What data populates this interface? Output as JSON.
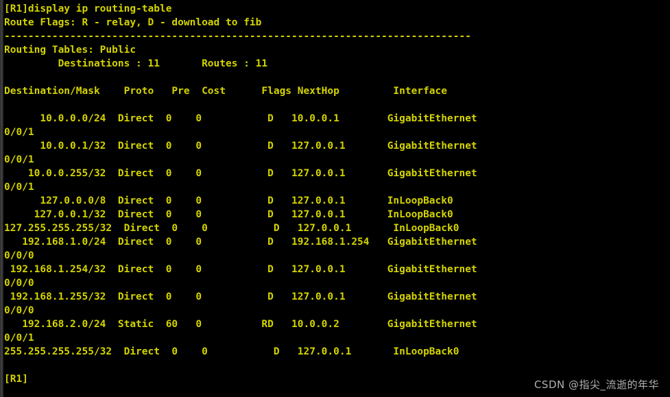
{
  "terminal": {
    "prompt": "[R1]",
    "command": "display ip routing-table",
    "command_line": "[R1]display ip routing-table",
    "flags_legend": "Route Flags: R - relay, D - download to fib",
    "separator": "------------------------------------------------------------------------------",
    "table_name": "Routing Tables: Public",
    "summary_line": "         Destinations : 11       Routes : 11",
    "destinations_label": "Destinations",
    "destinations_count": "11",
    "routes_label": "Routes",
    "routes_count": "11",
    "trailing_prompt": "[R1]",
    "colors": {
      "background": "#000000",
      "text": "#d4d400",
      "gutter": "#434343",
      "watermark": "#c9c9c9"
    }
  },
  "table": {
    "headers": {
      "destination_mask": "Destination/Mask",
      "proto": "Proto",
      "pre": "Pre",
      "cost": "Cost",
      "flags": "Flags",
      "nexthop": "NextHop",
      "interface": "Interface"
    },
    "header_line": "Destination/Mask    Proto   Pre  Cost      Flags NextHop         Interface",
    "rows": [
      {
        "destination_mask": "10.0.0.0/24",
        "proto": "Direct",
        "pre": "0",
        "cost": "0",
        "flags": "D",
        "nexthop": "10.0.0.1",
        "interface": "GigabitEthernet",
        "interface_cont": "0/0/1",
        "line": "      10.0.0.0/24  Direct  0    0           D   10.0.0.1        GigabitEthernet",
        "line_cont": "0/0/1"
      },
      {
        "destination_mask": "10.0.0.1/32",
        "proto": "Direct",
        "pre": "0",
        "cost": "0",
        "flags": "D",
        "nexthop": "127.0.0.1",
        "interface": "GigabitEthernet",
        "interface_cont": "0/0/1",
        "line": "      10.0.0.1/32  Direct  0    0           D   127.0.0.1       GigabitEthernet",
        "line_cont": "0/0/1"
      },
      {
        "destination_mask": "10.0.0.255/32",
        "proto": "Direct",
        "pre": "0",
        "cost": "0",
        "flags": "D",
        "nexthop": "127.0.0.1",
        "interface": "GigabitEthernet",
        "interface_cont": "0/0/1",
        "line": "    10.0.0.255/32  Direct  0    0           D   127.0.0.1       GigabitEthernet",
        "line_cont": "0/0/1"
      },
      {
        "destination_mask": "127.0.0.0/8",
        "proto": "Direct",
        "pre": "0",
        "cost": "0",
        "flags": "D",
        "nexthop": "127.0.0.1",
        "interface": "InLoopBack0",
        "interface_cont": "",
        "line": "      127.0.0.0/8  Direct  0    0           D   127.0.0.1       InLoopBack0",
        "line_cont": ""
      },
      {
        "destination_mask": "127.0.0.1/32",
        "proto": "Direct",
        "pre": "0",
        "cost": "0",
        "flags": "D",
        "nexthop": "127.0.0.1",
        "interface": "InLoopBack0",
        "interface_cont": "",
        "line": "     127.0.0.1/32  Direct  0    0           D   127.0.0.1       InLoopBack0",
        "line_cont": ""
      },
      {
        "destination_mask": "127.255.255.255/32",
        "proto": "Direct",
        "pre": "0",
        "cost": "0",
        "flags": "D",
        "nexthop": "127.0.0.1",
        "interface": "InLoopBack0",
        "interface_cont": "",
        "line": "127.255.255.255/32  Direct  0    0           D   127.0.0.1       InLoopBack0",
        "line_cont": ""
      },
      {
        "destination_mask": "192.168.1.0/24",
        "proto": "Direct",
        "pre": "0",
        "cost": "0",
        "flags": "D",
        "nexthop": "192.168.1.254",
        "interface": "GigabitEthernet",
        "interface_cont": "0/0/0",
        "line": "   192.168.1.0/24  Direct  0    0           D   192.168.1.254   GigabitEthernet",
        "line_cont": "0/0/0"
      },
      {
        "destination_mask": "192.168.1.254/32",
        "proto": "Direct",
        "pre": "0",
        "cost": "0",
        "flags": "D",
        "nexthop": "127.0.0.1",
        "interface": "GigabitEthernet",
        "interface_cont": "0/0/0",
        "line": " 192.168.1.254/32  Direct  0    0           D   127.0.0.1       GigabitEthernet",
        "line_cont": "0/0/0"
      },
      {
        "destination_mask": "192.168.1.255/32",
        "proto": "Direct",
        "pre": "0",
        "cost": "0",
        "flags": "D",
        "nexthop": "127.0.0.1",
        "interface": "GigabitEthernet",
        "interface_cont": "0/0/0",
        "line": " 192.168.1.255/32  Direct  0    0           D   127.0.0.1       GigabitEthernet",
        "line_cont": "0/0/0"
      },
      {
        "destination_mask": "192.168.2.0/24",
        "proto": "Static",
        "pre": "60",
        "cost": "0",
        "flags": "RD",
        "nexthop": "10.0.0.2",
        "interface": "GigabitEthernet",
        "interface_cont": "0/0/1",
        "line": "   192.168.2.0/24  Static  60   0          RD   10.0.0.2        GigabitEthernet",
        "line_cont": "0/0/1"
      },
      {
        "destination_mask": "255.255.255.255/32",
        "proto": "Direct",
        "pre": "0",
        "cost": "0",
        "flags": "D",
        "nexthop": "127.0.0.1",
        "interface": "InLoopBack0",
        "interface_cont": "",
        "line": "255.255.255.255/32  Direct  0    0           D   127.0.0.1       InLoopBack0",
        "line_cont": ""
      }
    ]
  },
  "watermark": {
    "text": "CSDN @指尖_流逝的年华"
  }
}
